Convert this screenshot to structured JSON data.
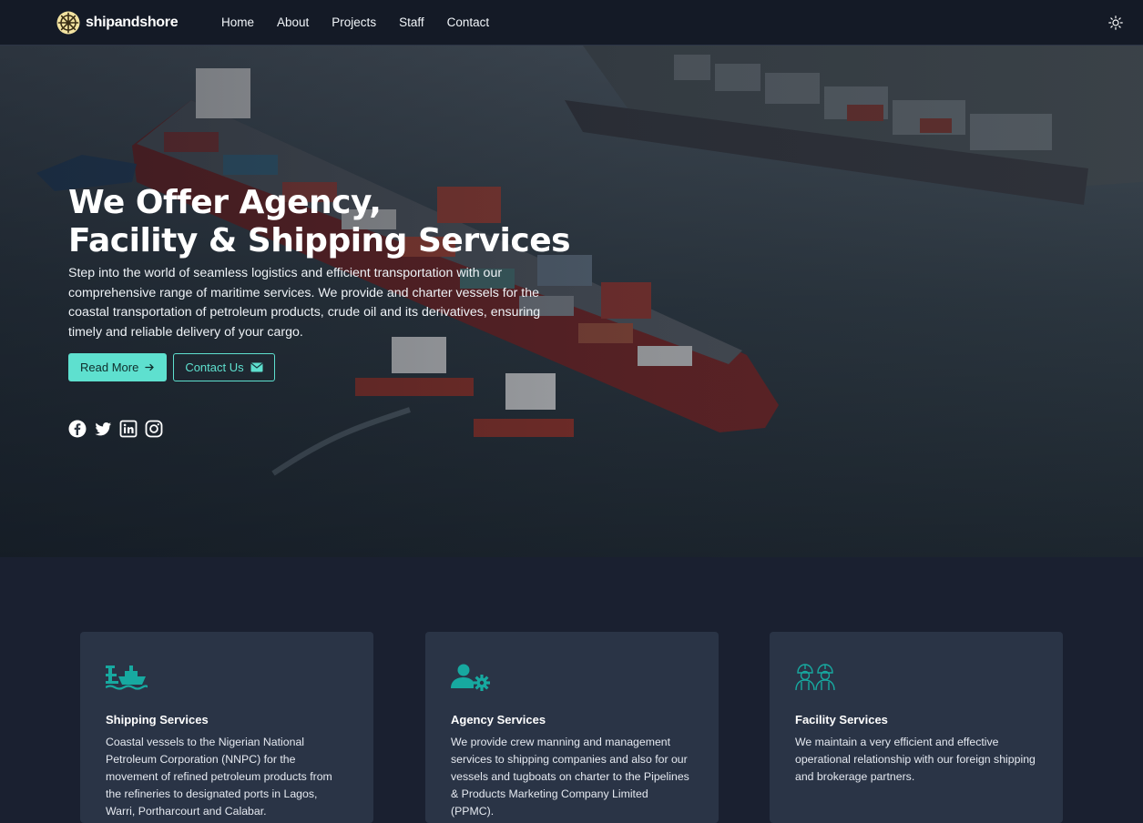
{
  "nav": {
    "brand": "shipandshore",
    "links": [
      "Home",
      "About",
      "Projects",
      "Staff",
      "Contact"
    ],
    "theme_icon": "sun-icon"
  },
  "hero": {
    "title_line1": "We Offer Agency,",
    "title_line2": "Facility & Shipping Services",
    "description": "Step into the world of seamless logistics and efficient transportation with our comprehensive range of maritime services. We provide and charter vessels for the coastal transportation of petroleum products, crude oil and its derivatives, ensuring timely and reliable delivery of your cargo.",
    "read_more": "Read More",
    "contact_us": "Contact Us",
    "social": [
      "facebook-icon",
      "twitter-icon",
      "linkedin-icon",
      "instagram-icon"
    ]
  },
  "services": [
    {
      "icon": "ship-port-icon",
      "title": "Shipping Services",
      "text": "Coastal vessels to the Nigerian National Petroleum Corporation (NNPC) for the movement of refined petroleum products from the refineries to designated ports in Lagos, Warri, Portharcourt and Calabar."
    },
    {
      "icon": "user-gear-icon",
      "title": "Agency Services",
      "text": "We provide crew manning and management services to shipping companies and also for our vessels and tugboats on charter to the Pipelines & Products Marketing Company Limited (PPMC)."
    },
    {
      "icon": "workers-icon",
      "title": "Facility Services",
      "text": "We maintain a very efficient and effective operational relationship with our foreign shipping and brokerage partners."
    }
  ],
  "colors": {
    "accent": "#5ee0cf",
    "icon_teal": "#17a9a0",
    "nav_bg": "#141a26",
    "page_bg": "#1a2030",
    "card_bg": "#2a3446"
  }
}
